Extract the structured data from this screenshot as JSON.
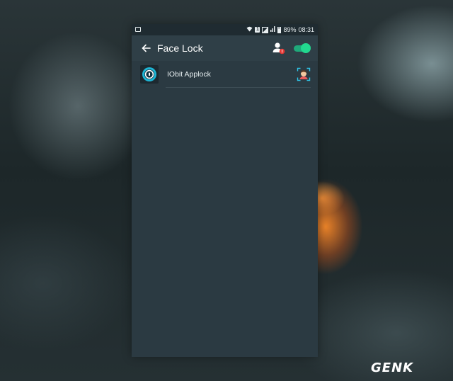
{
  "status_bar": {
    "battery": "89%",
    "time": "08:31",
    "sim_label": "1"
  },
  "toolbar": {
    "title": "Face Lock",
    "toggle_on": true,
    "accent": "#22d88f"
  },
  "apps": [
    {
      "label": "IObit Applock",
      "icon": "iobit-applock-icon"
    }
  ],
  "colors": {
    "panel": "#2b3a42",
    "toolbar": "#2f3f47",
    "status_bar": "#1f2b31",
    "badge": "#e53935"
  },
  "watermark": {
    "text": "GENK"
  }
}
